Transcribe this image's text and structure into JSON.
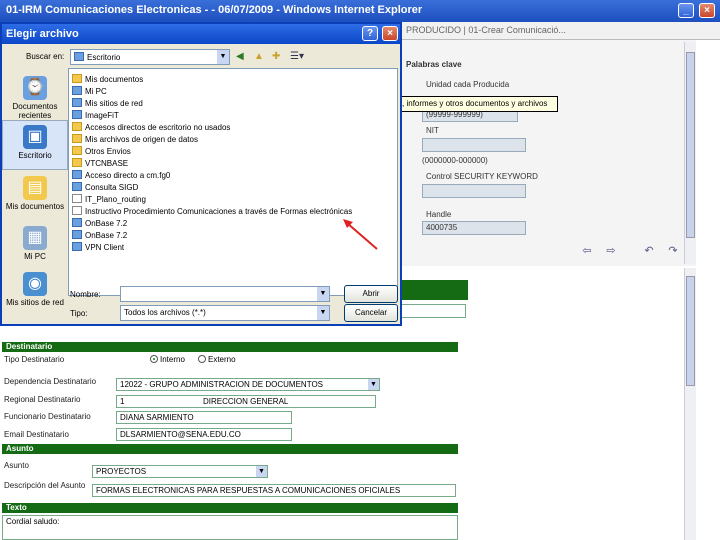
{
  "window": {
    "title": "01-IRM Comunicaciones Electronicas - - 06/07/2009 - Windows Internet Explorer",
    "minimize": "_",
    "close": "×"
  },
  "browser_tab": {
    "label": "PRODUCIDO | 01-Crear Comunicació..."
  },
  "right_panel": {
    "palabras_clave": "Palabras clave",
    "unidad_label": "Unidad cada Producida",
    "unidad_value": "(99999-999999)",
    "nit_label": "NIT",
    "range_label": "(0000000-000000)",
    "control_label": "Control SECURITY KEYWORD",
    "handle_label": "Handle",
    "handle_value": "4000735"
  },
  "tooltip": {
    "text": "Contiene cartas, informes y otros documentos y archivos"
  },
  "dialog": {
    "title": "Elegir archivo",
    "help": "?",
    "close": "×",
    "buscar_en_label": "Buscar en:",
    "buscar_en_value": "Escritorio",
    "places": [
      {
        "label": "Documentos recientes",
        "icon": "recent-documents-icon"
      },
      {
        "label": "Escritorio",
        "icon": "desktop-icon"
      },
      {
        "label": "Mis documentos",
        "icon": "my-documents-icon"
      },
      {
        "label": "Mi PC",
        "icon": "my-computer-icon"
      },
      {
        "label": "Mis sitios de red",
        "icon": "network-places-icon"
      }
    ],
    "files": [
      {
        "name": "Mis documentos",
        "icon": "folder"
      },
      {
        "name": "Mi PC",
        "icon": "sys"
      },
      {
        "name": "Mis sitios de red",
        "icon": "sys"
      },
      {
        "name": "ImageFiT",
        "icon": "sys"
      },
      {
        "name": "Accesos directos de escritorio no usados",
        "icon": "folder"
      },
      {
        "name": "Mis archivos de origen de datos",
        "icon": "folder"
      },
      {
        "name": "Otros Envios",
        "icon": "folder"
      },
      {
        "name": "VTCNBASE",
        "icon": "folder"
      },
      {
        "name": "Acceso directo a cm.fg0",
        "icon": "sys"
      },
      {
        "name": "Consulta SIGD",
        "icon": "sys"
      },
      {
        "name": "IT_Plano_routing",
        "icon": "doc"
      },
      {
        "name": "Instructivo Procedimiento Comunicaciones a través de Formas electrónicas",
        "icon": "doc"
      },
      {
        "name": "OnBase 7.2",
        "icon": "sys"
      },
      {
        "name": "OnBase 7.2",
        "icon": "sys"
      },
      {
        "name": "VPN Client",
        "icon": "sys"
      }
    ],
    "nombre_label": "Nombre:",
    "nombre_value": "",
    "tipo_label": "Tipo:",
    "tipo_value": "Todos los archivos (*.*)",
    "abrir_button": "Abrir",
    "cancelar_button": "Cancelar"
  },
  "form": {
    "destinatario_header": "Destinatario",
    "tipo_destinatario_label": "Tipo Destinatario",
    "interno": "Interno",
    "externo": "Externo",
    "dependencia_label": "Dependencia Destinatario",
    "dependencia_value": "12022 - GRUPO ADMINISTRACION DE DOCUMENTOS",
    "regional_label": "Regional Destinatario",
    "regional_code": "1",
    "regional_value": "DIRECCION GENERAL",
    "funcionario_label": "Funcionario Destinatario",
    "funcionario_value": "DIANA SARMIENTO",
    "email_label": "Email Destinatario",
    "email_value": "DLSARMIENTO@SENA.EDU.CO",
    "asunto_header": "Asunto",
    "asunto_label": "Asunto",
    "asunto_value": "PROYECTOS",
    "descripcion_label": "Descripción del Asunto",
    "descripcion_value": "FORMAS ELECTRONICAS PARA RESPUESTAS A COMUNICACIONES OFICIALES",
    "texto_header": "Texto",
    "cordial_value": "Cordial saludo:"
  },
  "colors": {
    "form_header_green": "#146b14",
    "title_blue": "#1d4fbf"
  }
}
